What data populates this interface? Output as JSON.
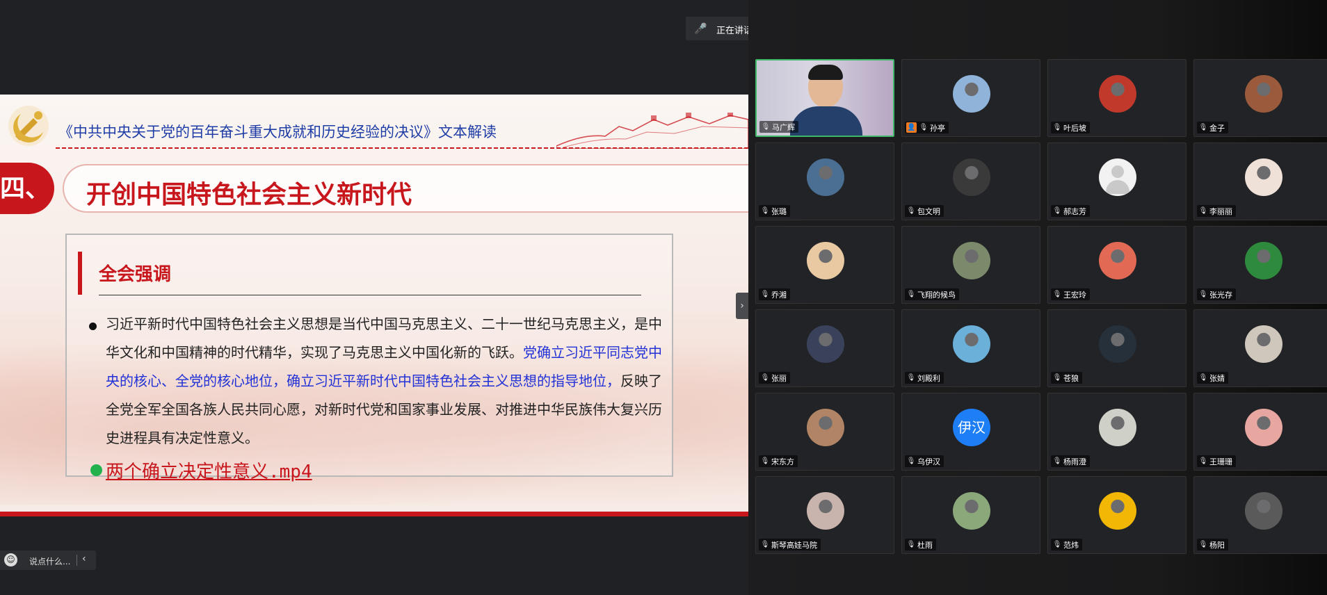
{
  "speaking": {
    "text": "正在讲话: 马广辉;"
  },
  "slide": {
    "doc_title": "《中共中央关于党的百年奋斗重大成就和历史经验的决议》文本解读",
    "section_no": "四、",
    "section_title": "开创中国特色社会主义新时代",
    "box_heading": "全会强调",
    "para_1": "习近平新时代中国特色社会主义思想是当代中国马克思主义、二十一世纪马克思主义，是中华文化和中国精神的时代精华，实现了马克思主义中国化新的飞跃。",
    "para_highlight": "党确立习近平同志党中央的核心、全党的核心地位，确立习近平新时代中国特色社会主义思想的指导地位，",
    "para_2": "反映了全党全军全国各族人民共同心愿，对新时代党和国家事业发展、对推进中华民族伟大复兴历史进程具有决定性意义。",
    "video_link": "两个确立决定性意义.mp4",
    "accent_color": "#c8161d",
    "highlight_color": "#2232d6"
  },
  "chat": {
    "placeholder": "说点什么..."
  },
  "participants": [
    {
      "name": "马广辉",
      "type": "video"
    },
    {
      "name": "孙亭",
      "type": "avatar",
      "host": true
    },
    {
      "name": "叶后坡",
      "type": "avatar"
    },
    {
      "name": "金子",
      "type": "avatar"
    },
    {
      "name": "张璐",
      "type": "avatar"
    },
    {
      "name": "包文明",
      "type": "avatar"
    },
    {
      "name": "郝志芳",
      "type": "default"
    },
    {
      "name": "李丽丽",
      "type": "avatar"
    },
    {
      "name": "乔湘",
      "type": "avatar"
    },
    {
      "name": "飞翔的候鸟",
      "type": "avatar"
    },
    {
      "name": "王宏玲",
      "type": "avatar"
    },
    {
      "name": "张光存",
      "type": "avatar"
    },
    {
      "name": "张丽",
      "type": "avatar"
    },
    {
      "name": "刘殿利",
      "type": "avatar"
    },
    {
      "name": "苍狼",
      "type": "avatar"
    },
    {
      "name": "张婧",
      "type": "avatar"
    },
    {
      "name": "宋东方",
      "type": "avatar"
    },
    {
      "name": "乌伊汉",
      "type": "text",
      "initials": "伊汉"
    },
    {
      "name": "杨雨澄",
      "type": "avatar"
    },
    {
      "name": "王珊珊",
      "type": "avatar"
    },
    {
      "name": "斯琴高娃马院",
      "type": "avatar"
    },
    {
      "name": "杜雨",
      "type": "avatar"
    },
    {
      "name": "范炜",
      "type": "avatar"
    },
    {
      "name": "杨阳",
      "type": "avatar"
    }
  ],
  "icons": {
    "mic": "microphone-icon",
    "host": "host-badge-icon",
    "emoji": "emoji-icon",
    "collapse": "chevron-right-icon",
    "chat_collapse": "chevron-left-icon"
  },
  "colors": {
    "active_speaker_border": "#3fb86a",
    "tile_bg": "#222326",
    "host_badge": "#f07a21"
  }
}
